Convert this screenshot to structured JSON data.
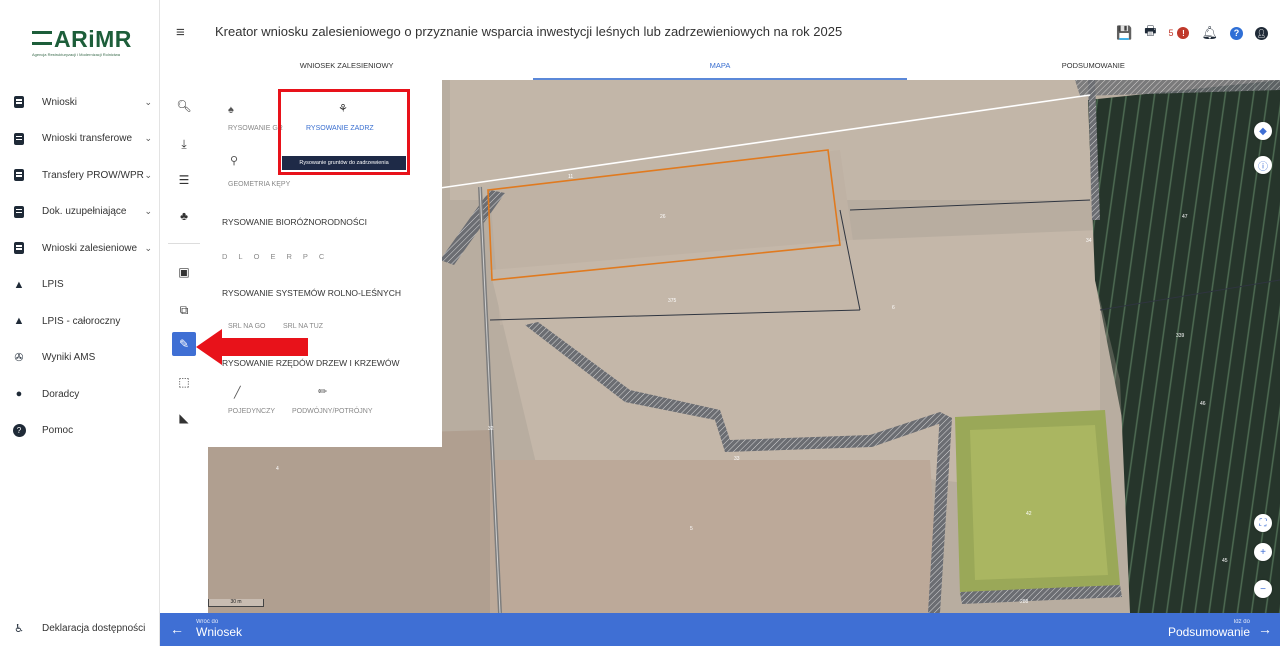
{
  "logo": {
    "name": "ARiMR",
    "subtitle": "Agencja Restrukturyzacji i Modernizacji Rolnictwa"
  },
  "sidebar": {
    "items": [
      {
        "label": "Wnioski",
        "icon": "document-icon",
        "has_chevron": true
      },
      {
        "label": "Wnioski transferowe",
        "icon": "document-icon",
        "has_chevron": true
      },
      {
        "label": "Transfery PROW/WPR",
        "icon": "document-icon",
        "has_chevron": true
      },
      {
        "label": "Dok. uzupełniające",
        "icon": "document-icon",
        "has_chevron": true
      },
      {
        "label": "Wnioski zalesieniowe",
        "icon": "document-icon",
        "has_chevron": true
      },
      {
        "label": "LPIS",
        "icon": "mountain-icon",
        "has_chevron": false
      },
      {
        "label": "LPIS - całoroczny",
        "icon": "mountain-icon",
        "has_chevron": false
      },
      {
        "label": "Wyniki AMS",
        "icon": "satellite-icon",
        "has_chevron": false
      },
      {
        "label": "Doradcy",
        "icon": "user-icon",
        "has_chevron": false
      },
      {
        "label": "Pomoc",
        "icon": "help-icon",
        "has_chevron": false
      }
    ],
    "accessibility_label": "Deklaracja dostępności"
  },
  "header": {
    "title": "Kreator wniosku zalesieniowego o przyznanie wsparcia inwestycji leśnych lub zadrzewieniowych na rok 2025",
    "notification_count": "5",
    "alert_mark": "!",
    "help_mark": "?",
    "tabs": [
      {
        "label": "WNIOSEK ZALESIENIOWY",
        "active": false
      },
      {
        "label": "MAPA",
        "active": true
      },
      {
        "label": "PODSUMOWANIE",
        "active": false
      }
    ]
  },
  "panel": {
    "item_rysowanie_gr": "RYSOWANIE GR",
    "item_rysowanie_zadrz": "RYSOWANIE ZADRZ",
    "tooltip": "Rysowanie gruntów do zadrzewienia",
    "item_geometria_kepy": "GEOMETRIA KĘPY",
    "heading_bioroznorodnosc": "RYSOWANIE BIORÓŻNORODNOŚCI",
    "biodiversity_letters": [
      "D",
      "L",
      "O",
      "E",
      "R",
      "P",
      "C"
    ],
    "heading_rolno_lesne": "RYSOWANIE SYSTEMÓW ROLNO-LEŚNYCH",
    "item_srl_go": "SRL NA GO",
    "item_srl_tuz": "SRL NA TUZ",
    "heading_rzedy": "RYSOWANIE RZĘDÓW DRZEW I KRZEWÓW",
    "item_pojedynczy": "POJEDYNCZY",
    "item_podwojny": "PODWÓJNY/POTRÓJNY"
  },
  "map": {
    "parcel_labels": [
      "11",
      "26",
      "375",
      "6",
      "34",
      "47",
      "339",
      "46",
      "32",
      "33",
      "4",
      "42",
      "5",
      "45",
      "288"
    ],
    "scale_label": "30 m"
  },
  "footer": {
    "back_small": "Wróć do",
    "back_big": "Wniosek",
    "forward_small": "Idź do",
    "forward_big": "Podsumowanie"
  },
  "colors": {
    "accent": "#3f6fd4",
    "highlight_red": "#e8121a",
    "selected_parcel": "#e07a1f",
    "logo_green": "#1d5e3a"
  }
}
